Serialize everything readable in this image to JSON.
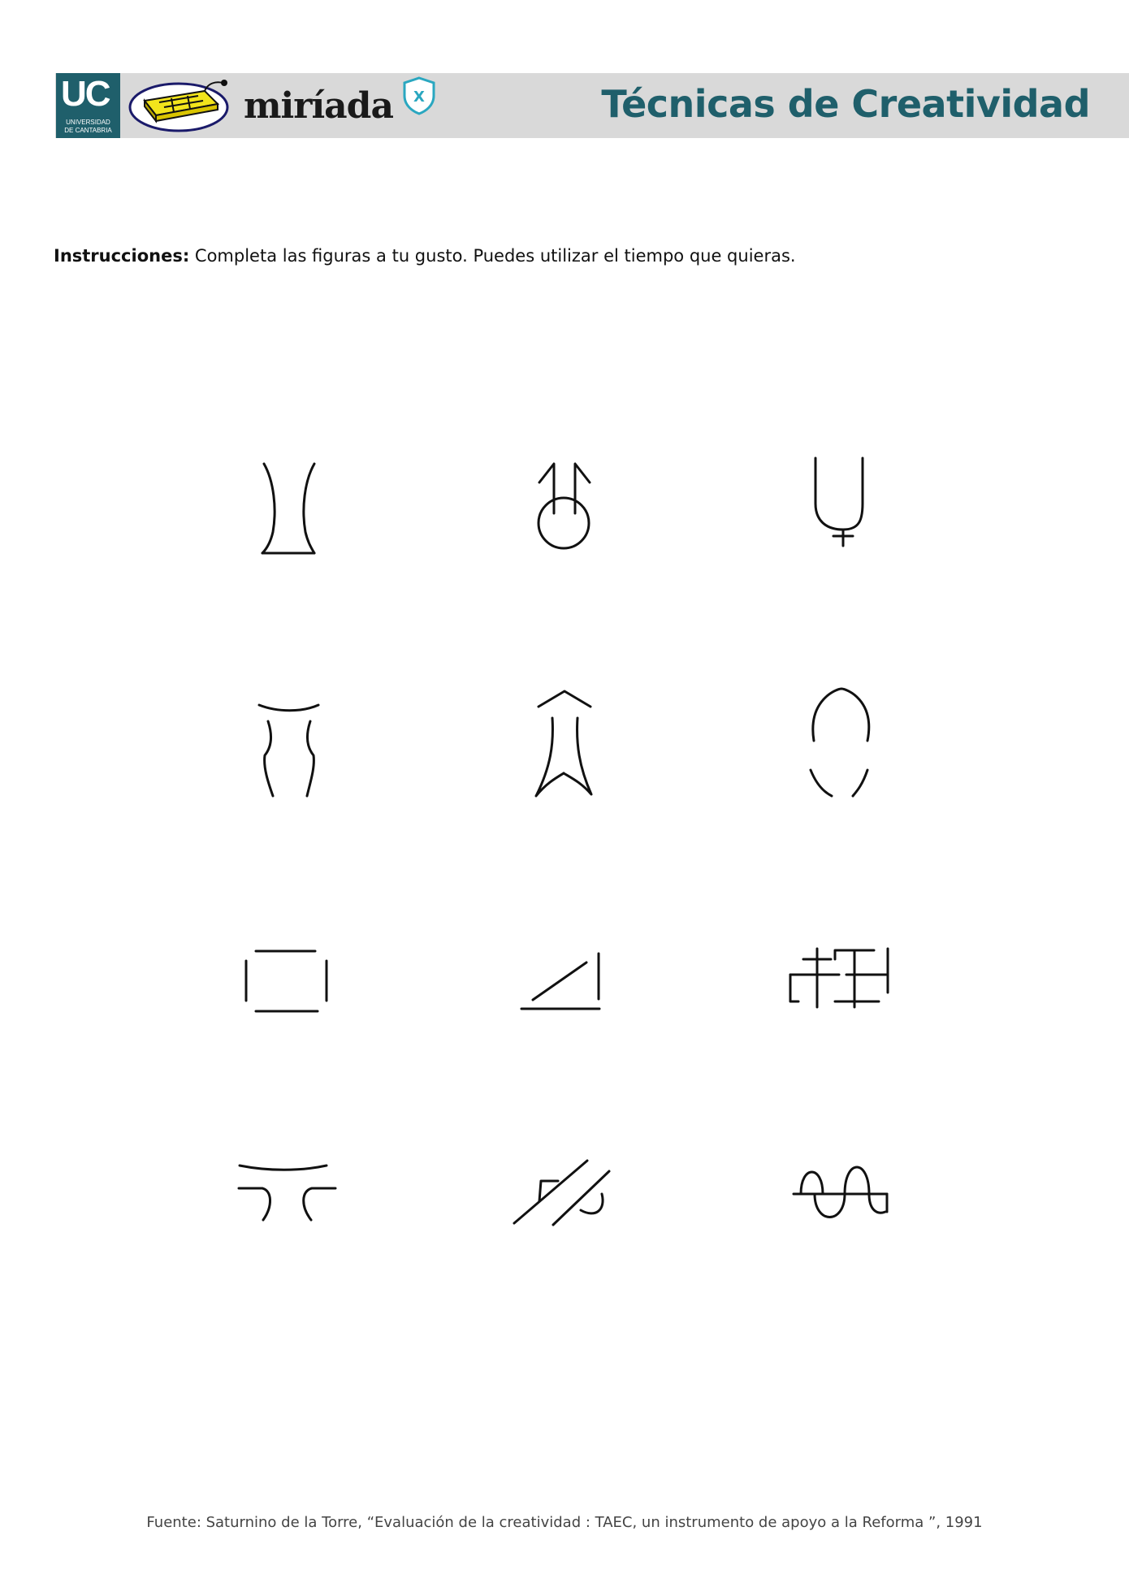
{
  "header": {
    "uc_logo_letters": "UC",
    "uc_logo_line1": "UNIVERSIDAD",
    "uc_logo_line2": "DE CANTABRIA",
    "platform_name": "miríada",
    "platform_badge": "X",
    "title": "Técnicas de Creatividad",
    "bar_color": "#d9d9d9",
    "accent_color": "#1f5f6b"
  },
  "instructions": {
    "label": "Instrucciones:",
    "text": " Completa las figuras a tu gusto. Puedes utilizar el tiempo que quieras."
  },
  "figures": {
    "rows": 4,
    "columns": 3,
    "items": [
      "incomplete-figure-1",
      "incomplete-figure-2",
      "incomplete-figure-3",
      "incomplete-figure-4",
      "incomplete-figure-5",
      "incomplete-figure-6",
      "incomplete-figure-7",
      "incomplete-figure-8",
      "incomplete-figure-9",
      "incomplete-figure-10",
      "incomplete-figure-11",
      "incomplete-figure-12"
    ]
  },
  "footer": {
    "source": "Fuente: Saturnino de la Torre, “Evaluación de la creatividad : TAEC, un instrumento de apoyo a la Reforma ”, 1991"
  }
}
